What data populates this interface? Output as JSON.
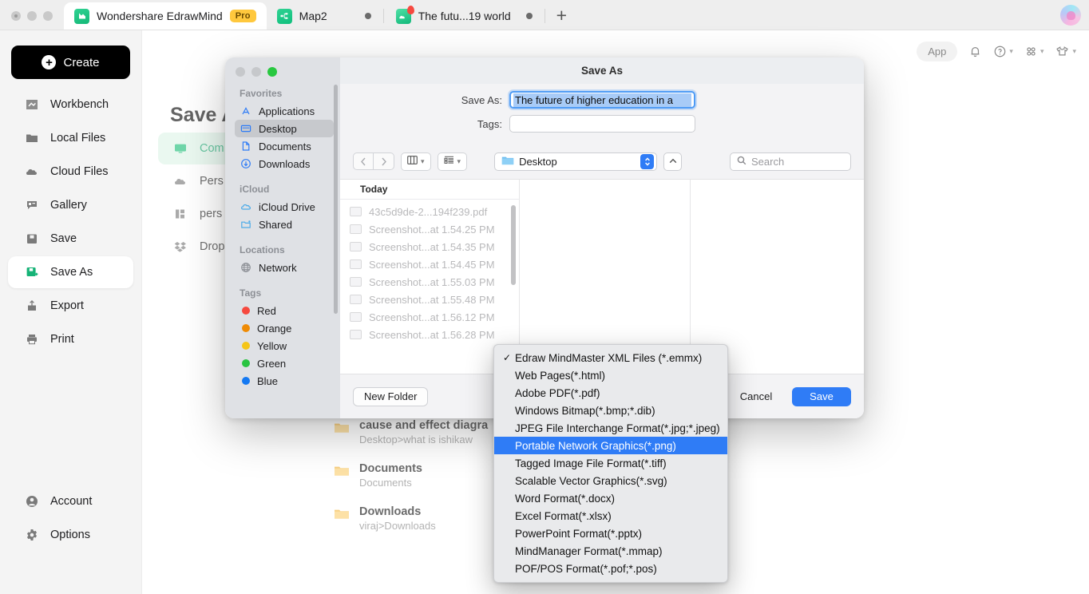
{
  "window": {
    "tabs": [
      {
        "label": "Wondershare EdrawMind",
        "badge": "Pro",
        "icon": "edrawmind-icon",
        "active": true
      },
      {
        "label": "Map2",
        "icon": "map-icon",
        "active": false
      },
      {
        "label": "The futu...19 world",
        "icon": "cloud-doc-icon",
        "active": false
      }
    ],
    "new_tab_label": "+"
  },
  "sidebar": {
    "create_label": "Create",
    "items": [
      {
        "label": "Workbench",
        "icon": "workbench-icon"
      },
      {
        "label": "Local Files",
        "icon": "folder-icon"
      },
      {
        "label": "Cloud Files",
        "icon": "cloud-icon"
      },
      {
        "label": "Gallery",
        "icon": "gallery-icon"
      },
      {
        "label": "Save",
        "icon": "save-icon"
      },
      {
        "label": "Save As",
        "icon": "save-as-icon"
      },
      {
        "label": "Export",
        "icon": "export-icon"
      },
      {
        "label": "Print",
        "icon": "print-icon"
      }
    ],
    "bottom_items": [
      {
        "label": "Account",
        "icon": "account-icon"
      },
      {
        "label": "Options",
        "icon": "gear-icon"
      }
    ]
  },
  "topbar": {
    "app_label": "App",
    "icons": [
      "bell-icon",
      "help-icon",
      "apps-grid-icon",
      "theme-shirt-icon"
    ]
  },
  "background_page": {
    "title": "Save As",
    "destinations": [
      {
        "label": "Com",
        "icon": "computer-icon",
        "selected": true
      },
      {
        "label": "Pers",
        "icon": "cloud-icon",
        "selected": false
      },
      {
        "label": "pers",
        "icon": "team-icon",
        "selected": false
      },
      {
        "label": "Drop",
        "icon": "dropbox-icon",
        "selected": false
      }
    ],
    "recent_folders": [
      {
        "name": "cause and effect diagra",
        "path": "Desktop>what is ishikaw"
      },
      {
        "name": "Documents",
        "path": "Documents"
      },
      {
        "name": "Downloads",
        "path": "viraj>Downloads"
      }
    ]
  },
  "dialog": {
    "title": "Save As",
    "save_as_label": "Save As:",
    "filename_value": "The future of higher education in a ",
    "tags_label": "Tags:",
    "tags_value": "",
    "sidebar": [
      {
        "section": "Favorites",
        "items": [
          {
            "label": "Applications",
            "icon": "applications-icon",
            "selected": false
          },
          {
            "label": "Desktop",
            "icon": "desktop-icon",
            "selected": true
          },
          {
            "label": "Documents",
            "icon": "documents-icon",
            "selected": false
          },
          {
            "label": "Downloads",
            "icon": "downloads-icon",
            "selected": false
          }
        ]
      },
      {
        "section": "iCloud",
        "items": [
          {
            "label": "iCloud Drive",
            "icon": "icloud-icon",
            "selected": false
          },
          {
            "label": "Shared",
            "icon": "shared-folder-icon",
            "selected": false
          }
        ]
      },
      {
        "section": "Locations",
        "items": [
          {
            "label": "Network",
            "icon": "network-icon",
            "selected": false
          }
        ]
      },
      {
        "section": "Tags",
        "items": [
          {
            "label": "Red",
            "icon": "tag-dot-icon",
            "color": "#f6493f",
            "selected": false
          },
          {
            "label": "Orange",
            "icon": "tag-dot-icon",
            "color": "#ef8b05",
            "selected": false
          },
          {
            "label": "Yellow",
            "icon": "tag-dot-icon",
            "color": "#f5c518",
            "selected": false
          },
          {
            "label": "Green",
            "icon": "tag-dot-icon",
            "color": "#29c441",
            "selected": false
          },
          {
            "label": "Blue",
            "icon": "tag-dot-icon",
            "color": "#1579f2",
            "selected": false
          }
        ]
      }
    ],
    "toolbar": {
      "back_icon": "chevron-left-icon",
      "forward_icon": "chevron-right-icon",
      "view_columns_icon": "column-view-icon",
      "group_icon": "group-view-icon",
      "path_value": "Desktop",
      "up_icon": "chevron-up-icon",
      "search_placeholder": "Search",
      "search_value": ""
    },
    "file_list": {
      "group_header": "Today",
      "files": [
        "43c5d9de-2...194f239.pdf",
        "Screenshot...at 1.54.25 PM",
        "Screenshot...at 1.54.35 PM",
        "Screenshot...at 1.54.45 PM",
        "Screenshot...at 1.55.03 PM",
        "Screenshot...at 1.55.48 PM",
        "Screenshot...at 1.56.12 PM",
        "Screenshot...at 1.56.28 PM"
      ]
    },
    "buttons": {
      "new_folder": "New Folder",
      "cancel": "Cancel",
      "save": "Save"
    }
  },
  "format_dropdown": {
    "selected_index": 5,
    "checked_index": 0,
    "items": [
      "Edraw MindMaster XML Files (*.emmx)",
      "Web Pages(*.html)",
      "Adobe PDF(*.pdf)",
      "Windows Bitmap(*.bmp;*.dib)",
      "JPEG File Interchange Format(*.jpg;*.jpeg)",
      "Portable Network Graphics(*.png)",
      "Tagged Image File Format(*.tiff)",
      "Scalable Vector Graphics(*.svg)",
      "Word Format(*.docx)",
      "Excel Format(*.xlsx)",
      "PowerPoint Format(*.pptx)",
      "MindManager Format(*.mmap)",
      "POF/POS Format(*.pof;*.pos)"
    ]
  },
  "colors": {
    "accent_blue": "#2f7cf6",
    "brand_green": "#18a971",
    "pro_yellow": "#ffc83d"
  }
}
